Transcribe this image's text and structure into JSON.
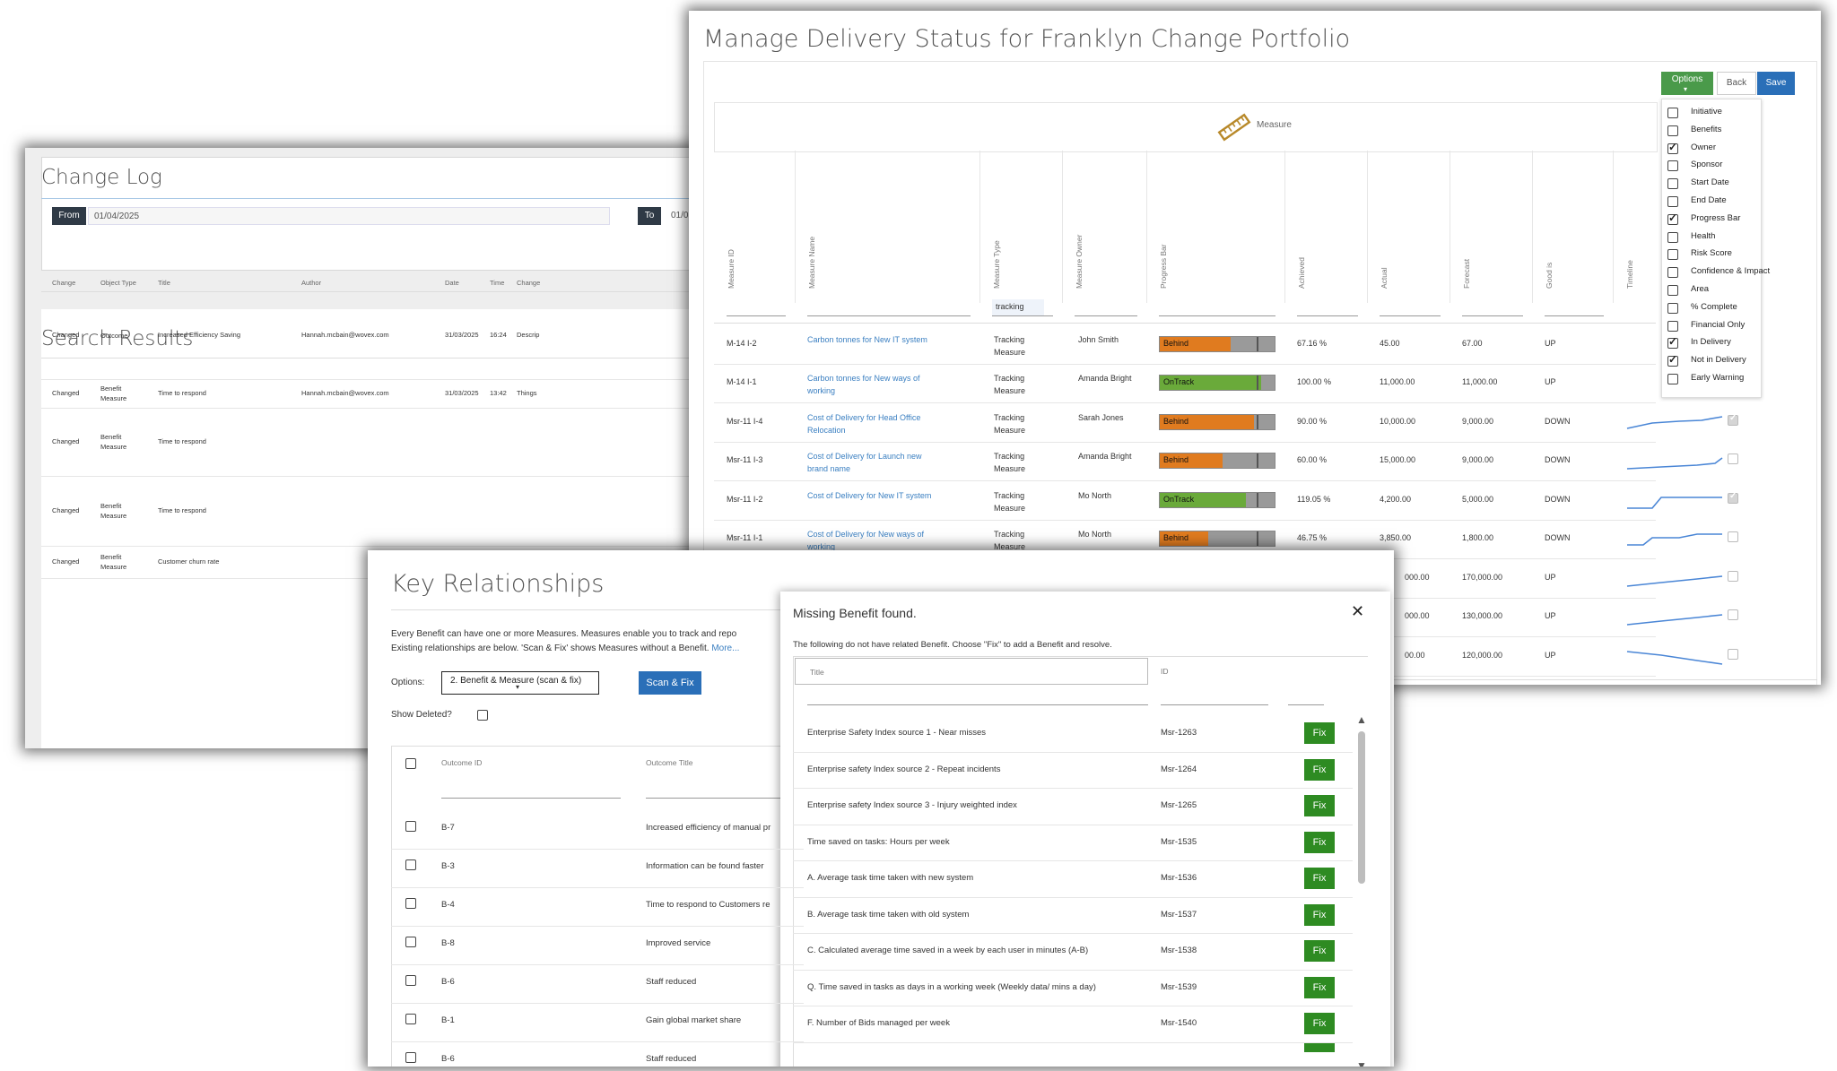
{
  "change_log": {
    "title": "Change Log",
    "from_label": "From",
    "from_value": "01/04/2025",
    "to_label": "To",
    "to_value": "01/0"
  },
  "search_results": {
    "title": "Search Results",
    "columns": [
      "Change",
      "Object Type",
      "Title",
      "Author",
      "Date",
      "Time",
      "Change"
    ],
    "rows": [
      {
        "change": "Changed",
        "type": "Outcome",
        "title": "Increased Efficiency Saving",
        "author": "Hannah.mcbain@wovex.com",
        "date": "31/03/2025",
        "time": "16:24",
        "extra": "Descrip"
      },
      {
        "change": "Changed",
        "type": "Benefit Measure",
        "title": "Time to respond",
        "author": "Hannah.mcbain@wovex.com",
        "date": "31/03/2025",
        "time": "13:42",
        "extra": "Things"
      },
      {
        "change": "Changed",
        "type": "Benefit Measure",
        "title": "Time to respond",
        "author": "",
        "date": "",
        "time": "",
        "extra": ""
      },
      {
        "change": "Changed",
        "type": "Benefit Measure",
        "title": "Time to respond",
        "author": "",
        "date": "",
        "time": "",
        "extra": ""
      },
      {
        "change": "Changed",
        "type": "Benefit Measure",
        "title": "Customer churn rate",
        "author": "",
        "date": "",
        "time": "",
        "extra": ""
      }
    ]
  },
  "delivery": {
    "title": "Manage Delivery Status for Franklyn Change Portfolio",
    "buttons": {
      "options": "Options",
      "back": "Back",
      "save": "Save"
    },
    "group_header": "Measure",
    "group_icon": "ruler-icon",
    "columns": [
      "Measure ID",
      "Measure Name",
      "Measure Type",
      "Measure Owner",
      "Progress Bar",
      "Achieved",
      "Actual",
      "Forecast",
      "Good is",
      "Timeline"
    ],
    "filter_value": "tracking",
    "rows": [
      {
        "id": "M-14 I-2",
        "name": "Carbon tonnes for New IT system",
        "type": "Tracking Measure",
        "owner": "John Smith",
        "status": "Behind",
        "progress": 0.62,
        "achieved": "67.16 %",
        "actual": "45.00",
        "forecast": "67.00",
        "good": "UP",
        "check": null
      },
      {
        "id": "M-14 I-1",
        "name": "Carbon tonnes for New ways of working",
        "type": "Tracking Measure",
        "owner": "Amanda Bright",
        "status": "OnTrack",
        "progress": 0.88,
        "achieved": "100.00 %",
        "actual": "11,000.00",
        "forecast": "11,000.00",
        "good": "UP",
        "check": null
      },
      {
        "id": "Msr-11 I-4",
        "name": "Cost of Delivery for Head Office Relocation",
        "type": "Tracking Measure",
        "owner": "Sarah Jones",
        "status": "Behind",
        "progress": 0.82,
        "achieved": "90.00 %",
        "actual": "10,000.00",
        "forecast": "9,000.00",
        "good": "DOWN",
        "check": true
      },
      {
        "id": "Msr-11 I-3",
        "name": "Cost of Delivery for Launch new brand name",
        "type": "Tracking Measure",
        "owner": "Amanda Bright",
        "status": "Behind",
        "progress": 0.55,
        "achieved": "60.00 %",
        "actual": "15,000.00",
        "forecast": "9,000.00",
        "good": "DOWN",
        "check": false
      },
      {
        "id": "Msr-11 I-2",
        "name": "Cost of Delivery for New IT system",
        "type": "Tracking Measure",
        "owner": "Mo North",
        "status": "OnTrack",
        "progress": 0.75,
        "achieved": "119.05 %",
        "actual": "4,200.00",
        "forecast": "5,000.00",
        "good": "DOWN",
        "check": true
      },
      {
        "id": "Msr-11 I-1",
        "name": "Cost of Delivery for New ways of working",
        "type": "Tracking Measure",
        "owner": "Mo North",
        "status": "Behind",
        "progress": 0.42,
        "achieved": "46.75 %",
        "actual": "3,850.00",
        "forecast": "1,800.00",
        "good": "DOWN",
        "check": false
      },
      {
        "id": "",
        "name": "",
        "type": "",
        "owner": "",
        "status": "",
        "progress": 0,
        "achieved": "",
        "actual": "000.00",
        "forecast": "170,000.00",
        "good": "UP",
        "check": false
      },
      {
        "id": "",
        "name": "",
        "type": "",
        "owner": "",
        "status": "",
        "progress": 0,
        "achieved": "",
        "actual": "000.00",
        "forecast": "130,000.00",
        "good": "UP",
        "check": false
      },
      {
        "id": "",
        "name": "",
        "type": "",
        "owner": "",
        "status": "",
        "progress": 0,
        "achieved": "",
        "actual": "00.00",
        "forecast": "120,000.00",
        "good": "UP",
        "check": false
      }
    ],
    "options_menu": [
      {
        "label": "Initiative",
        "checked": false
      },
      {
        "label": "Benefits",
        "checked": false
      },
      {
        "label": "Owner",
        "checked": true
      },
      {
        "label": "Sponsor",
        "checked": false
      },
      {
        "label": "Start Date",
        "checked": false
      },
      {
        "label": "End Date",
        "checked": false
      },
      {
        "label": "Progress Bar",
        "checked": true
      },
      {
        "label": "Health",
        "checked": false
      },
      {
        "label": "Risk Score",
        "checked": false
      },
      {
        "label": "Confidence & Impact",
        "checked": false
      },
      {
        "label": "Area",
        "checked": false
      },
      {
        "label": "% Complete",
        "checked": false
      },
      {
        "label": "Financial Only",
        "checked": false
      },
      {
        "label": "In Delivery",
        "checked": true
      },
      {
        "label": "Not in Delivery",
        "checked": true
      },
      {
        "label": "Early Warning",
        "checked": false
      }
    ],
    "colors": {
      "behind": "#e07b1f",
      "ontrack": "#6aaa3a",
      "options_btn": "#4a9a4a",
      "save_btn": "#2a6fb8"
    }
  },
  "key_relationships": {
    "title": "Key Relationships",
    "description_1": "Every Benefit can have one or more Measures. Measures enable you to track and repo",
    "description_2": "Existing relationships are below. 'Scan & Fix' shows Measures without a Benefit.",
    "more_link": "More...",
    "options_label": "Options:",
    "options_value": "2. Benefit & Measure (scan & fix)",
    "scan_button": "Scan & Fix",
    "show_deleted_label": "Show Deleted?",
    "columns": [
      "Outcome ID",
      "Outcome Title"
    ],
    "rows": [
      {
        "id": "B-7",
        "title": "Increased efficiency of manual pr"
      },
      {
        "id": "B-3",
        "title": "Information can be found faster"
      },
      {
        "id": "B-4",
        "title": "Time to respond to Customers re"
      },
      {
        "id": "B-8",
        "title": "Improved service"
      },
      {
        "id": "B-6",
        "title": "Staff reduced"
      },
      {
        "id": "B-1",
        "title": "Gain global market share"
      },
      {
        "id": "B-6",
        "title": "Staff reduced"
      }
    ]
  },
  "missing_dialog": {
    "title": "Missing Benefit found.",
    "subtitle": "The following do not have related Benefit. Choose \"Fix\" to add a Benefit and resolve.",
    "col_title": "Title",
    "col_id": "ID",
    "fix_label": "Fix",
    "rows": [
      {
        "title": "Enterprise Safety Index source 1 - Near misses",
        "id": "Msr-1263"
      },
      {
        "title": "Enterprise safety Index source 2 - Repeat incidents",
        "id": "Msr-1264"
      },
      {
        "title": "Enterprise safety Index source 3 - Injury weighted index",
        "id": "Msr-1265"
      },
      {
        "title": "Time saved on tasks: Hours per week",
        "id": "Msr-1535"
      },
      {
        "title": "A. Average task time taken with new system",
        "id": "Msr-1536"
      },
      {
        "title": "B. Average task time taken with old system",
        "id": "Msr-1537"
      },
      {
        "title": "C. Calculated average time saved in a week by each user in minutes (A-B)",
        "id": "Msr-1538"
      },
      {
        "title": "Q. Time saved in tasks as days in a working week (Weekly data/ mins a day)",
        "id": "Msr-1539"
      },
      {
        "title": "F. Number of Bids managed per week",
        "id": "Msr-1540"
      }
    ]
  }
}
